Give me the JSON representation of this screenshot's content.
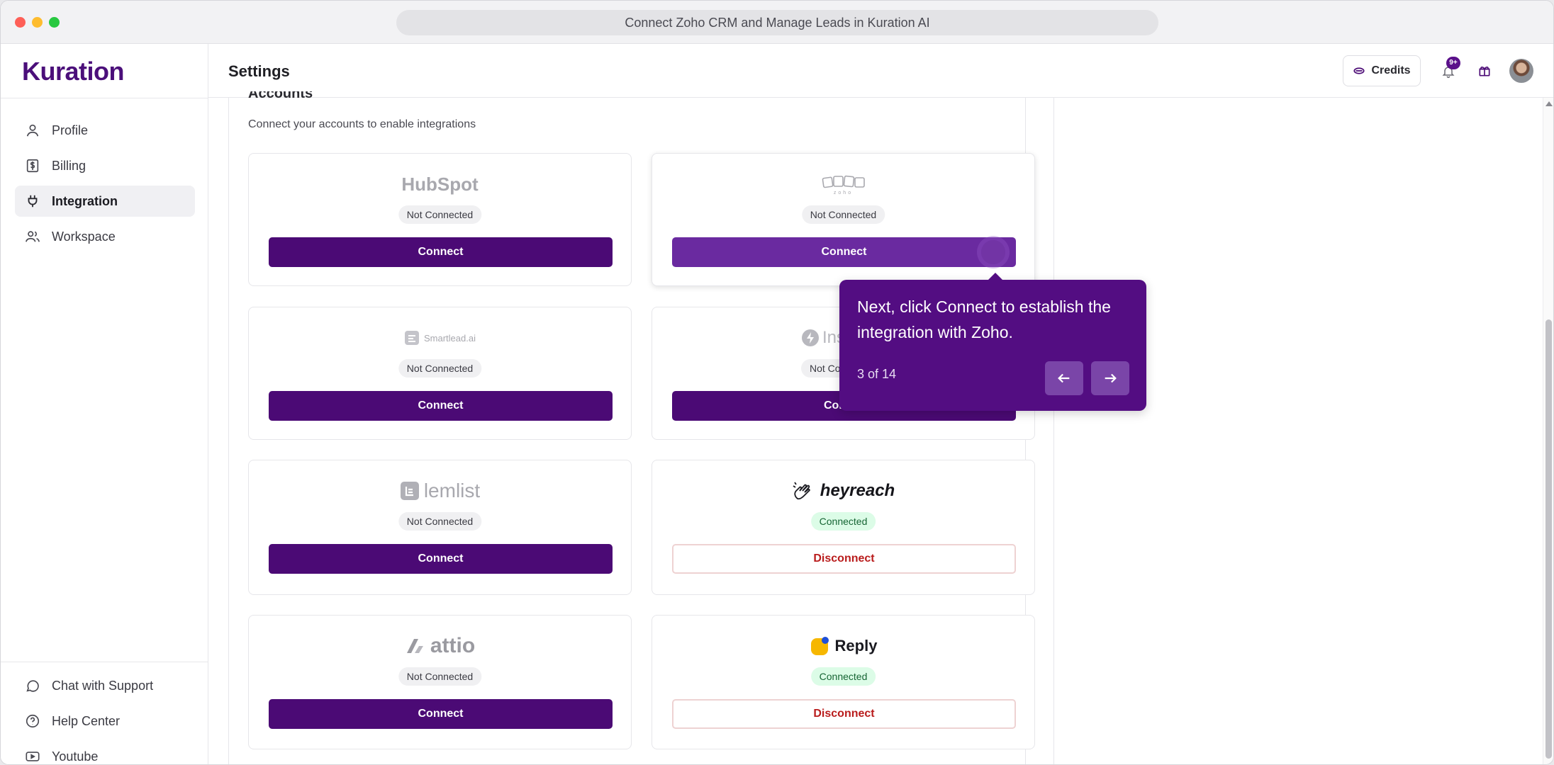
{
  "browser": {
    "title": "Connect Zoho CRM and Manage Leads in Kuration AI"
  },
  "sidebar": {
    "logo": "Kuration",
    "items": [
      {
        "label": "Profile",
        "icon": "user-icon"
      },
      {
        "label": "Billing",
        "icon": "dollar-icon"
      },
      {
        "label": "Integration",
        "icon": "plug-icon",
        "active": true
      },
      {
        "label": "Workspace",
        "icon": "users-icon"
      }
    ],
    "bottom_items": [
      {
        "label": "Chat with Support",
        "icon": "chat-icon"
      },
      {
        "label": "Help Center",
        "icon": "help-icon"
      },
      {
        "label": "Youtube",
        "icon": "youtube-icon"
      }
    ]
  },
  "header": {
    "title": "Settings",
    "credits_label": "Credits",
    "notification_count": "9+"
  },
  "accounts": {
    "title": "Accounts",
    "subtitle": "Connect your accounts to enable integrations",
    "cards": [
      {
        "brand": "HubSpot",
        "status": "Not Connected",
        "action": "Connect"
      },
      {
        "brand": "zoho",
        "status": "Not Connected",
        "action": "Connect"
      },
      {
        "brand": "Smartlead.ai",
        "status": "Not Connected",
        "action": "Connect"
      },
      {
        "brand": "Ins",
        "status": "Not Co",
        "action": "Con"
      },
      {
        "brand": "lemlist",
        "status": "Not Connected",
        "action": "Connect"
      },
      {
        "brand": "heyreach",
        "status": "Connected",
        "action": "Disconnect"
      },
      {
        "brand": "attio",
        "status": "Not Connected",
        "action": "Connect"
      },
      {
        "brand": "Reply",
        "status": "Connected",
        "action": "Disconnect"
      }
    ]
  },
  "tooltip": {
    "text": "Next, click Connect to establish the integration with Zoho.",
    "step": "3 of 14"
  },
  "colors": {
    "brand_purple": "#4b0a75",
    "tooltip_purple": "#530d82",
    "connected_bg": "#dcfce7",
    "disconnect_red": "#b91c1c"
  }
}
